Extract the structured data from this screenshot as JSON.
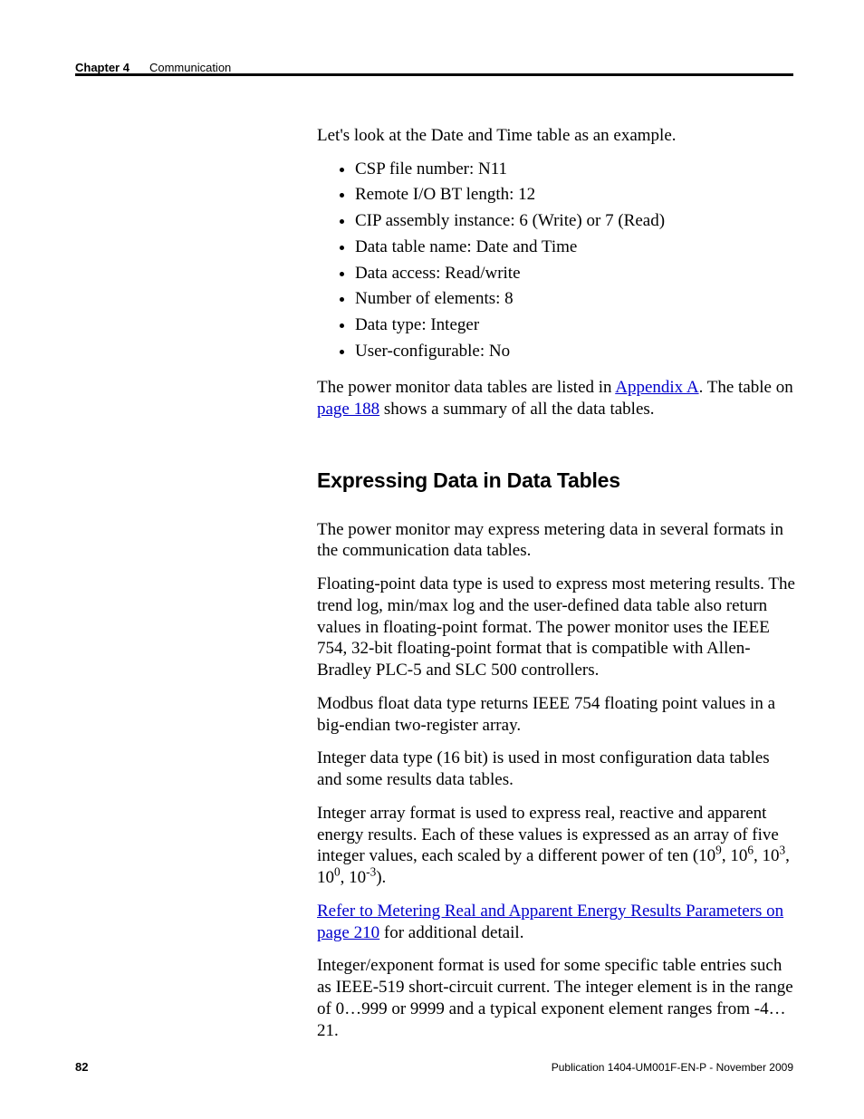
{
  "header": {
    "chapter": "Chapter 4",
    "title": "Communication"
  },
  "body": {
    "intro": "Let's look at the Date and Time table as an example.",
    "bullets": [
      "CSP file number: N11",
      "Remote I/O BT length: 12",
      "CIP assembly instance: 6 (Write) or 7 (Read)",
      "Data table name: Date and Time",
      "Data access: Read/write",
      "Number of elements: 8",
      "Data type: Integer",
      "User-configurable: No"
    ],
    "para_after_list_pre": "The power monitor data tables are listed in ",
    "link_appendix": "Appendix A",
    "para_after_list_mid": ". The table on ",
    "link_page188": "page 188",
    "para_after_list_post": " shows a summary of all the data tables.",
    "section_heading": "Expressing Data in Data Tables",
    "p1": "The power monitor may express metering data in several formats in the communication data tables.",
    "p2": "Floating-point data type is used to express most metering results. The trend log, min/max log and the user-defined data table also return values in floating-point format. The power monitor uses the IEEE 754, 32-bit floating-point format that is compatible with Allen-Bradley PLC-5 and SLC 500 controllers.",
    "p3": "Modbus float data type returns IEEE 754 floating point values in a big-endian two-register array.",
    "p4": "Integer data type (16 bit) is used in most configuration data tables and some results data tables.",
    "p5_pre": "Integer array format is used to express real, reactive and apparent energy results. Each of these values is expressed as an array of five integer values, each scaled by a different power of ten (10",
    "p5_e1": "9",
    "p5_s1": ", 10",
    "p5_e2": "6",
    "p5_s2": ", 10",
    "p5_e3": "3",
    "p5_s3": ", 10",
    "p5_e4": "0",
    "p5_s4": ", 10",
    "p5_e5": "-3",
    "p5_post": ").",
    "link_refer_pre": "Refer to  Metering Real and Apparent Energy Results Parameters on page 210",
    "p6_post": " for additional detail.",
    "p7": "Integer/exponent format is used for some specific table entries such as IEEE-519 short-circuit current. The integer element is in the range of 0…999 or 9999 and a typical exponent element ranges from -4…21."
  },
  "footer": {
    "pagenum": "82",
    "pubinfo": "Publication 1404-UM001F-EN-P - November 2009"
  }
}
